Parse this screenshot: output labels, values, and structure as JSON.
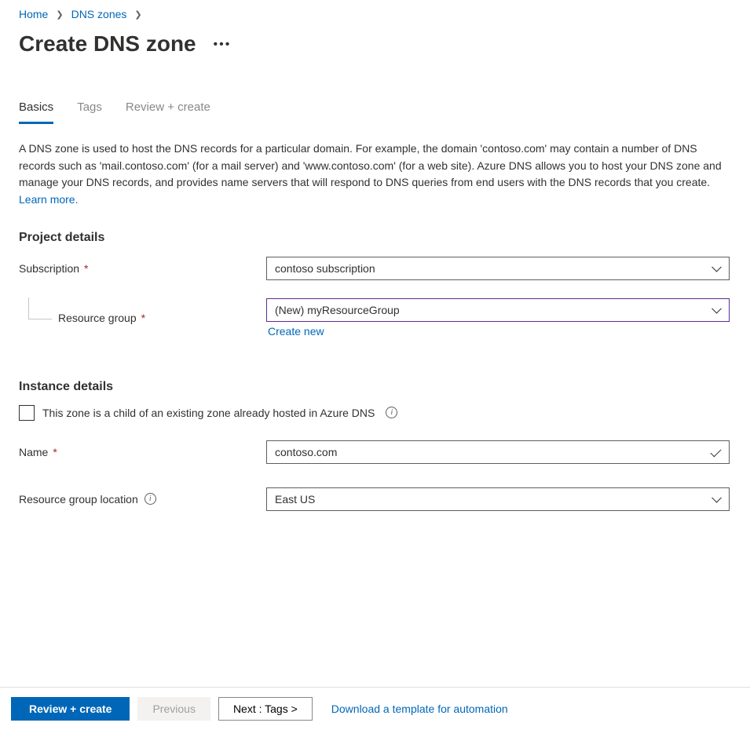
{
  "breadcrumb": {
    "items": [
      "Home",
      "DNS zones"
    ]
  },
  "title": "Create DNS zone",
  "tabs": {
    "items": [
      {
        "label": "Basics",
        "active": true
      },
      {
        "label": "Tags",
        "active": false
      },
      {
        "label": "Review + create",
        "active": false
      }
    ]
  },
  "intro": {
    "text": "A DNS zone is used to host the DNS records for a particular domain. For example, the domain 'contoso.com' may contain a number of DNS records such as 'mail.contoso.com' (for a mail server) and 'www.contoso.com' (for a web site). Azure DNS allows you to host your DNS zone and manage your DNS records, and provides name servers that will respond to DNS queries from end users with the DNS records that you create.  ",
    "learn_more": "Learn more."
  },
  "sections": {
    "project": {
      "heading": "Project details",
      "subscription_label": "Subscription",
      "subscription_value": "contoso subscription",
      "resource_group_label": "Resource group",
      "resource_group_value": "(New) myResourceGroup",
      "create_new": "Create new"
    },
    "instance": {
      "heading": "Instance details",
      "child_zone_label": "This zone is a child of an existing zone already hosted in Azure DNS",
      "name_label": "Name",
      "name_value": "contoso.com",
      "location_label": "Resource group location",
      "location_value": "East US"
    }
  },
  "footer": {
    "review": "Review + create",
    "previous": "Previous",
    "next": "Next : Tags >",
    "download": "Download a template for automation"
  }
}
